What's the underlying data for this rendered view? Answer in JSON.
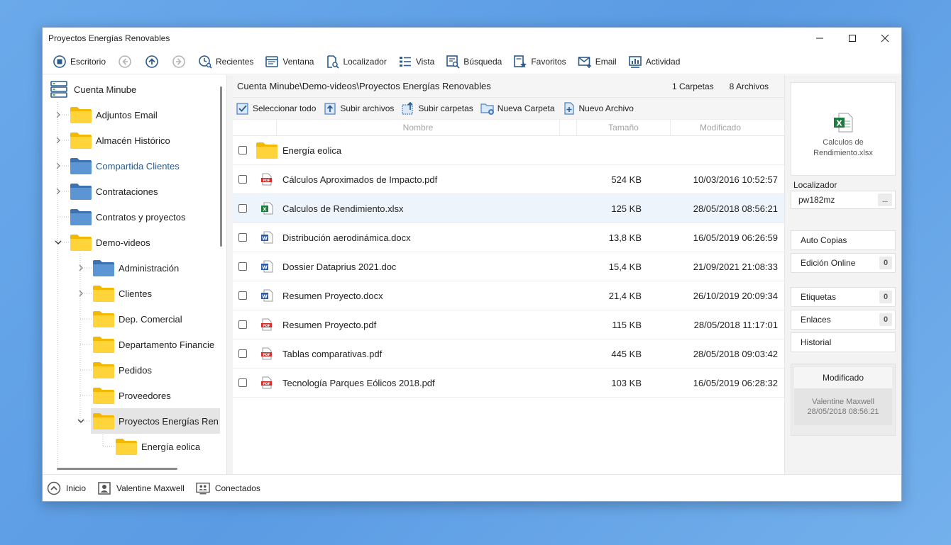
{
  "window": {
    "title": "Proyectos Energías Renovables"
  },
  "toolbar": {
    "desktop": "Escritorio",
    "items": [
      "Recientes",
      "Ventana",
      "Localizador",
      "Vista",
      "Búsqueda",
      "Favoritos",
      "Email",
      "Actividad"
    ]
  },
  "tree": {
    "root": "Cuenta Minube",
    "items": [
      "Adjuntos Email",
      "Almacén Histórico",
      "Compartida Clientes",
      "Contrataciones",
      "Contratos y proyectos",
      "Demo-videos",
      "Administración",
      "Clientes",
      "Dep. Comercial",
      "Departamento Financie",
      "Pedidos",
      "Proveedores",
      "Proyectos Energías Ren",
      "Energía eolica"
    ]
  },
  "content": {
    "path": "Cuenta Minube\\Demo-videos\\Proyectos Energías Renovables",
    "folders_count": "1 Carpetas",
    "files_count": "8 Archivos",
    "actions": [
      "Seleccionar todo",
      "Subir archivos",
      "Subir carpetas",
      "Nueva Carpeta",
      "Nuevo Archivo"
    ],
    "columns": {
      "name": "Nombre",
      "size": "Tamaño",
      "modified": "Modificado"
    },
    "rows": [
      {
        "type": "folder",
        "name": "Energía eolica",
        "size": "",
        "date": ""
      },
      {
        "type": "pdf",
        "name": "Cálculos Aproximados de Impacto.pdf",
        "size": "524 KB",
        "date": "10/03/2016 10:52:57"
      },
      {
        "type": "xlsx",
        "name": "Calculos de Rendimiento.xlsx",
        "size": "125 KB",
        "date": "28/05/2018 08:56:21"
      },
      {
        "type": "docx",
        "name": "Distribución aerodinámica.docx",
        "size": "13,8 KB",
        "date": "16/05/2019 06:26:59"
      },
      {
        "type": "docx",
        "name": "Dossier Dataprius 2021.doc",
        "size": "15,4 KB",
        "date": "21/09/2021 21:08:33"
      },
      {
        "type": "docx",
        "name": "Resumen Proyecto.docx",
        "size": "21,4 KB",
        "date": "26/10/2019 20:09:34"
      },
      {
        "type": "pdf",
        "name": "Resumen Proyecto.pdf",
        "size": "115 KB",
        "date": "28/05/2018 11:17:01"
      },
      {
        "type": "pdf",
        "name": "Tablas comparativas.pdf",
        "size": "445 KB",
        "date": "28/05/2018 09:03:42"
      },
      {
        "type": "pdf",
        "name": "Tecnología Parques Eólicos 2018.pdf",
        "size": "103 KB",
        "date": "16/05/2019 06:28:32"
      }
    ]
  },
  "side": {
    "preview_name": "Calculos de Rendimiento.xlsx",
    "locator_label": "Localizador",
    "locator_value": "pw182mz",
    "locator_btn": "...",
    "auto_copias": "Auto Copias",
    "edicion_online": "Edición Online",
    "edicion_count": "0",
    "etiquetas": "Etiquetas",
    "etiquetas_count": "0",
    "enlaces": "Enlaces",
    "enlaces_count": "0",
    "historial": "Historial",
    "modified_label": "Modificado",
    "modified_by": "Valentine Maxwell",
    "modified_date": "28/05/2018 08:56:21"
  },
  "status": {
    "home": "Inicio",
    "user": "Valentine Maxwell",
    "connected": "Conectados"
  },
  "colors": {
    "accent": "#2b5a8c",
    "folder_yellow": "#f5b800",
    "folder_blue": "#4a84c4",
    "pdf_red": "#d62b2b",
    "xlsx_green": "#1e7b3e",
    "docx_blue": "#2a5aa8"
  }
}
